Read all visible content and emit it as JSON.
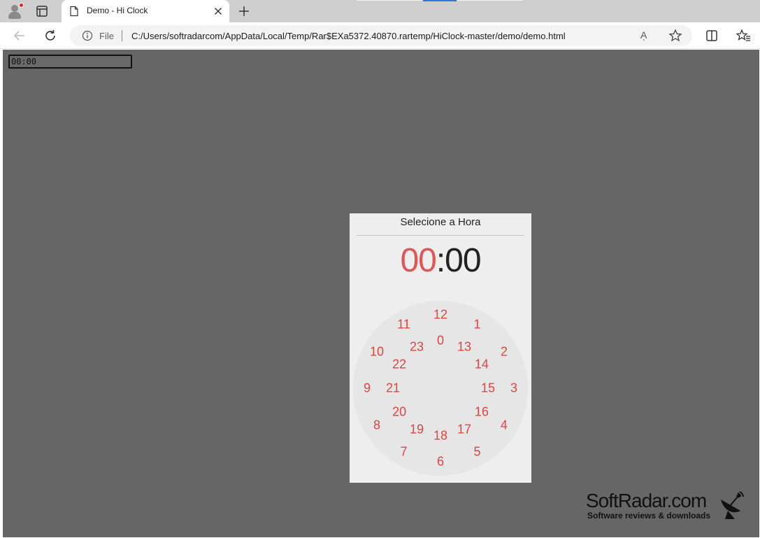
{
  "browser": {
    "tab_title": "Demo - Hi Clock",
    "address_scheme": "File",
    "address_url": "C:/Users/softradarcom/AppData/Local/Temp/Rar$EXa5372.40870.rartemp/HiClock-master/demo/demo.html",
    "read_aloud_label": "Aͅ"
  },
  "page": {
    "time_input_value": "00:00",
    "picker": {
      "heading": "Selecione a Hora",
      "hours": "00",
      "separator": ":",
      "minutes": "00",
      "outer_hours": [
        "12",
        "1",
        "2",
        "3",
        "4",
        "5",
        "6",
        "7",
        "8",
        "9",
        "10",
        "11"
      ],
      "inner_hours": [
        "0",
        "13",
        "14",
        "15",
        "16",
        "17",
        "18",
        "19",
        "20",
        "21",
        "22",
        "23"
      ],
      "accent_color": "#e0443f"
    }
  },
  "watermark": {
    "brand": "SoftRadar.com",
    "tagline": "Software reviews & downloads"
  }
}
